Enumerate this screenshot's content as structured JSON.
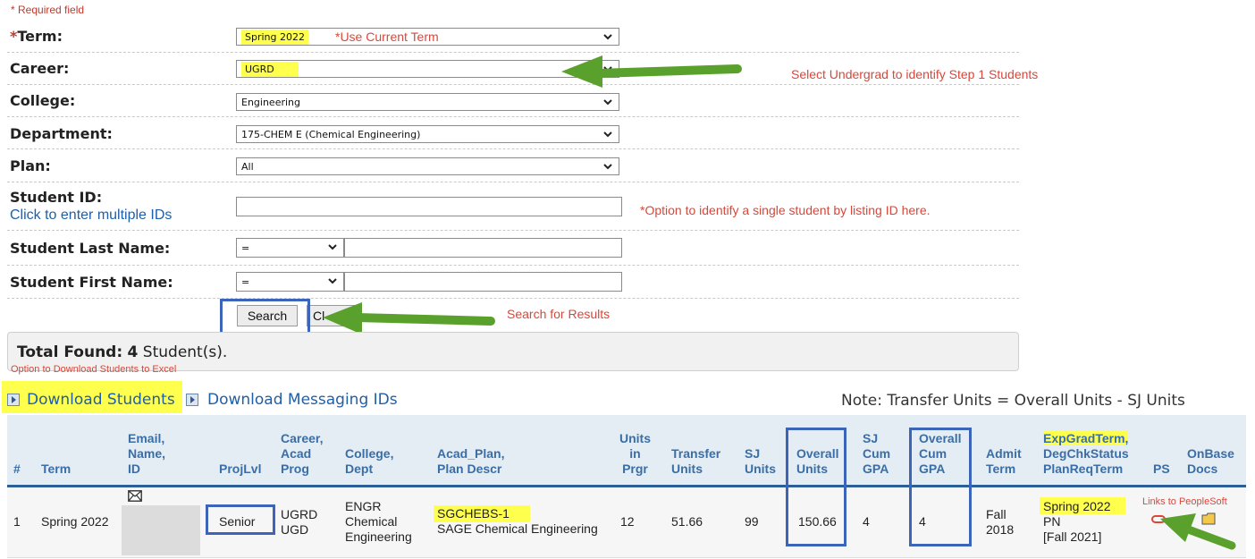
{
  "required_note": "* Required field",
  "form": {
    "term": {
      "star": "*",
      "label": "Term:",
      "value": "Spring 2022",
      "hint": "*Use Current Term"
    },
    "career": {
      "label": "Career:",
      "value": "UGRD",
      "note": "Select Undergrad to identify Step 1 Students"
    },
    "college": {
      "label": "College:",
      "value": "Engineering"
    },
    "department": {
      "label": "Department:",
      "value": "175-CHEM E (Chemical Engineering)"
    },
    "plan": {
      "label": "Plan:",
      "value": "All"
    },
    "student_id": {
      "label": "Student ID:",
      "link": "Click to enter multiple IDs",
      "value": "",
      "note": "*Option to identify a single student by listing ID here."
    },
    "last_name": {
      "label": "Student Last Name:",
      "operator": "=",
      "value": ""
    },
    "first_name": {
      "label": "Student First Name:",
      "operator": "=",
      "value": ""
    }
  },
  "buttons": {
    "search": "Search",
    "clear": "Cl",
    "search_note": "Search for Results"
  },
  "results": {
    "total_label": "Total Found:",
    "total_count": "4",
    "total_suffix": "Student(s).",
    "excel_note": "Option to Download Students to Excel",
    "download_students": "Download Students",
    "download_messaging": "Download Messaging IDs",
    "transfer_note": "Note: Transfer Units = Overall Units - SJ Units"
  },
  "table": {
    "headers": {
      "num": "#",
      "term": "Term",
      "email": [
        "Email,",
        "Name,",
        "ID"
      ],
      "projlvl": "ProjLvl",
      "career": [
        "Career,",
        "Acad",
        "Prog"
      ],
      "college": [
        "College,",
        "Dept"
      ],
      "acad_plan": [
        "Acad_Plan,",
        "Plan Descr"
      ],
      "units_prgr": [
        "Units",
        "in",
        "Prgr"
      ],
      "transfer": [
        "Transfer",
        "Units"
      ],
      "sj_units": [
        "SJ",
        "Units"
      ],
      "overall_units": [
        "Overall",
        "Units"
      ],
      "sj_gpa": [
        "SJ",
        "Cum",
        "GPA"
      ],
      "overall_gpa": [
        "Overall",
        "Cum",
        "GPA"
      ],
      "admit": [
        "Admit",
        "Term"
      ],
      "expgrad": [
        "ExpGradTerm,",
        "DegChkStatus",
        "PlanReqTerm"
      ],
      "ps": "PS",
      "onbase": [
        "OnBase",
        "Docs"
      ]
    },
    "rows": [
      {
        "num": "1",
        "term": "Spring 2022",
        "projlvl": "Senior",
        "career": "UGRD",
        "prog": "UGD",
        "college": "ENGR",
        "dept_line1": "Chemical",
        "dept_line2": "Engineering",
        "plan": "SGCHEBS-1",
        "plan_descr": "SAGE Chemical Engineering",
        "units_prgr": "12",
        "transfer": "51.66",
        "sj_units": "99",
        "overall_units": "150.66",
        "sj_gpa": "4",
        "overall_gpa": "4",
        "admit_line1": "Fall",
        "admit_line2": "2018",
        "expgrad": "Spring 2022",
        "degchk": "PN",
        "planreq": "[Fall 2021]",
        "ps_note": "Links to PeopleSoft"
      }
    ]
  },
  "colors": {
    "highlight": "#ffff4d",
    "annotation_red": "#d9473a",
    "link_blue": "#1f5fa8",
    "box_blue": "#3c64b8",
    "arrow_green": "#5aa02c",
    "header_text": "#3a6ea5"
  }
}
